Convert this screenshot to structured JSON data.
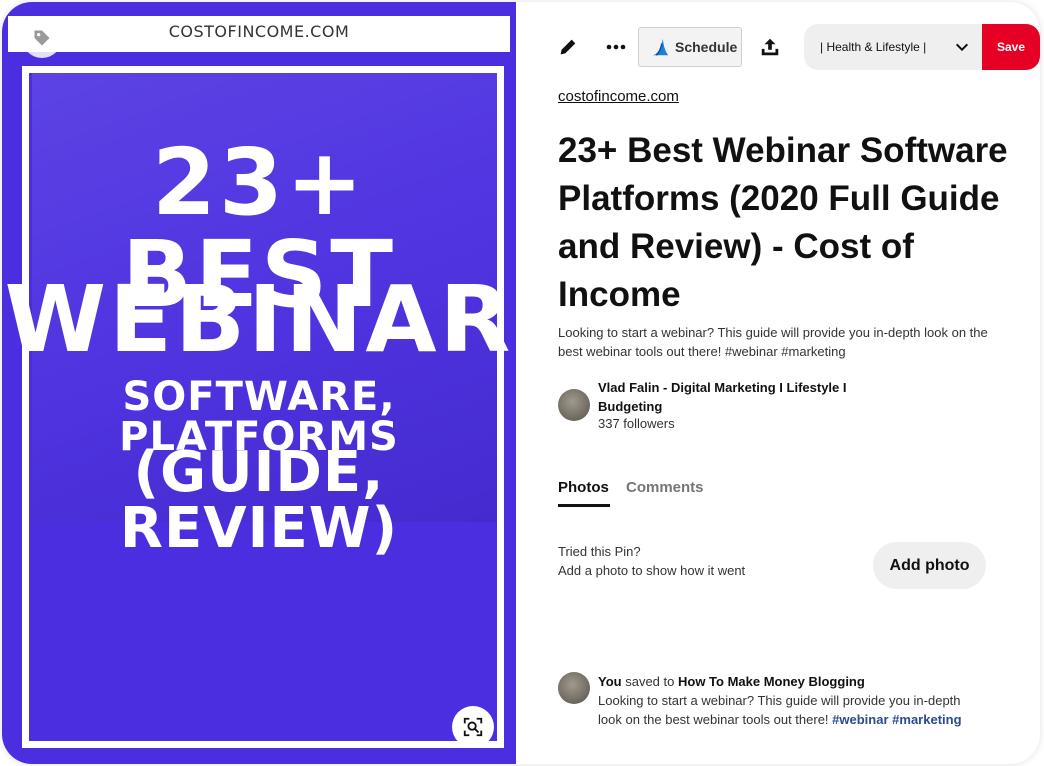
{
  "image": {
    "site_banner": "COSTOFINCOME.COM",
    "line1": "23+ BEST",
    "line2": "WEBINAR",
    "line3": "SOFTWARE, PLATFORMS",
    "line4": "(GUIDE, REVIEW)",
    "background_color": "#4a2ee0",
    "tag_icon": "tag-icon",
    "visual_search_icon": "lens-search-icon"
  },
  "toolbar": {
    "edit_icon": "pencil-icon",
    "more_icon": "ellipsis-icon",
    "schedule_label": "Schedule",
    "schedule_icon": "schedule-logo-icon",
    "share_icon": "share-upload-icon",
    "board_label": "| Health & Lifestyle |",
    "board_icon": "chevron-down-icon",
    "save_label": "Save",
    "save_color": "#e60023"
  },
  "pin": {
    "source": "costofincome.com",
    "title": "23+ Best Webinar Software Platforms (2020 Full Guide and Review) - Cost of Income",
    "description": "Looking to start a webinar? This guide will provide you in-depth look on the best webinar tools out there! #webinar #marketing"
  },
  "creator": {
    "name": "Vlad Falin - Digital Marketing I Lifestyle I Budgeting",
    "followers": "337 followers"
  },
  "tabs": [
    {
      "label": "Photos",
      "active": true
    },
    {
      "label": "Comments",
      "active": false
    }
  ],
  "tried": {
    "line1": "Tried this Pin?",
    "line2": "Add a photo to show how it went",
    "button_label": "Add photo"
  },
  "activity": {
    "user": "You",
    "verb": "saved to",
    "board": "How To Make Money Blogging",
    "text": "Looking to start a webinar? This guide will provide you in-depth look on the best webinar tools out there!",
    "hashtag1": "#webinar",
    "hashtag2": "#marketing"
  }
}
